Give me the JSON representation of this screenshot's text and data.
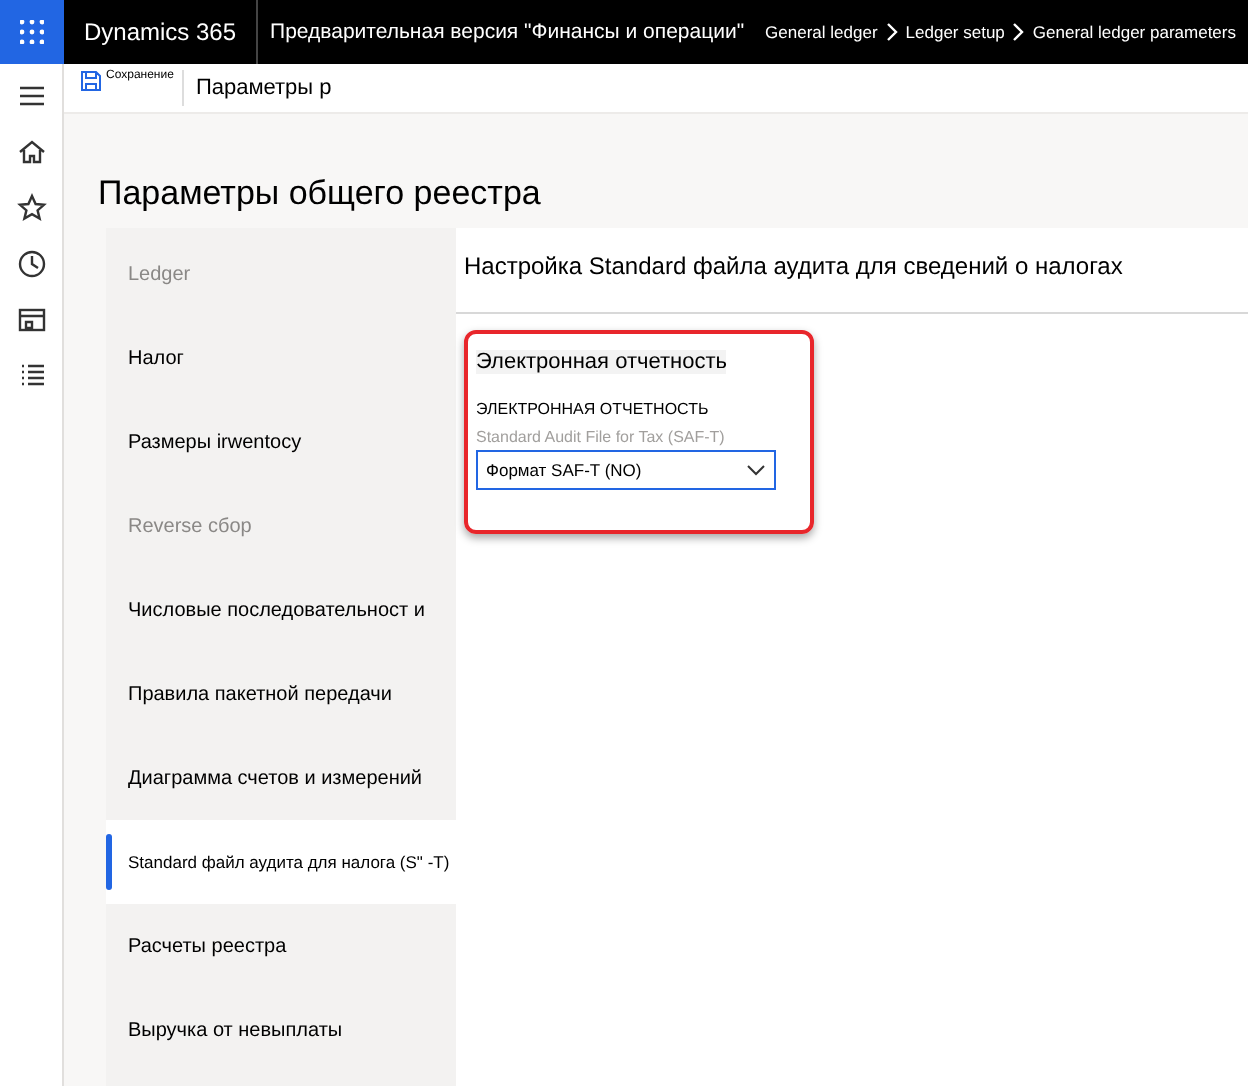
{
  "app": {
    "name": "Dynamics 365",
    "title": "Предварительная версия \"Финансы и операции\""
  },
  "breadcrumbs": [
    "General ledger",
    "Ledger setup",
    "General ledger parameters"
  ],
  "action_bar": {
    "save_label": "Сохранение",
    "page_name": "Параметры р"
  },
  "rail": [
    {
      "kind": "menu"
    },
    {
      "kind": "home"
    },
    {
      "kind": "star"
    },
    {
      "kind": "clock"
    },
    {
      "kind": "workspace"
    },
    {
      "kind": "list"
    }
  ],
  "page_title": "Параметры общего реестра",
  "sidebar": {
    "items": [
      {
        "label": "Ledger",
        "muted": true,
        "selected": false
      },
      {
        "label": "Налог",
        "muted": false,
        "selected": false
      },
      {
        "label": "Размеры irwentocy",
        "muted": false,
        "selected": false
      },
      {
        "label": "Reverse сбор",
        "muted": true,
        "selected": false
      },
      {
        "label": "Числовые последовательност и",
        "muted": false,
        "selected": false
      },
      {
        "label": "Правила пакетной передачи",
        "muted": false,
        "selected": false
      },
      {
        "label": "Диаграмма счетов и измерений",
        "muted": false,
        "selected": false
      },
      {
        "label": "Standard файл аудита для налога (S\" -T)",
        "muted": false,
        "selected": true
      },
      {
        "label": "Расчеты реестра",
        "muted": false,
        "selected": false
      },
      {
        "label": "Выручка от невыплаты",
        "muted": false,
        "selected": false
      }
    ]
  },
  "section": {
    "title": "Настройка Standard файла аудита для сведений о налогах",
    "group": {
      "title": "Электронная отчетность",
      "subheading": "ЭЛЕКТРОННАЯ ОТЧЕТНОСТЬ",
      "field_label": "Standard Audit File for Tax (SAF-T)",
      "field_value": "Формат SAF-T (NO)"
    }
  }
}
